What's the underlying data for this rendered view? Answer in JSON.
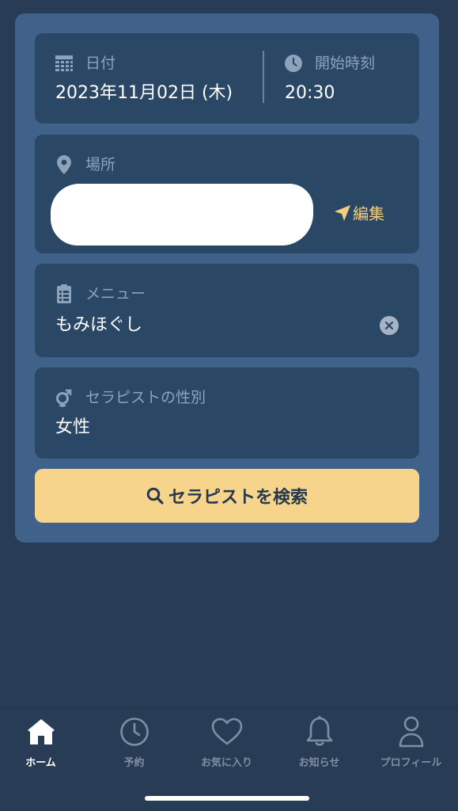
{
  "search_form": {
    "date": {
      "label": "日付",
      "value": "2023年11月02日 (木)"
    },
    "start_time": {
      "label": "開始時刻",
      "value": "20:30"
    },
    "location": {
      "label": "場所",
      "edit_label": "編集"
    },
    "menu": {
      "label": "メニュー",
      "value": "もみほぐし"
    },
    "therapist_gender": {
      "label": "セラピストの性別",
      "value": "女性"
    },
    "search_button_label": "セラピストを検索"
  },
  "tabbar": {
    "items": [
      {
        "label": "ホーム",
        "icon": "home-icon",
        "active": true
      },
      {
        "label": "予約",
        "icon": "clock-icon",
        "active": false
      },
      {
        "label": "お気に入り",
        "icon": "heart-icon",
        "active": false
      },
      {
        "label": "お知らせ",
        "icon": "bell-icon",
        "active": false
      },
      {
        "label": "プロフィール",
        "icon": "user-icon",
        "active": false
      }
    ]
  },
  "colors": {
    "background": "#283d55",
    "card": "#406189",
    "field": "#2a4866",
    "accent": "#f7d48b",
    "edit_accent": "#f3cd80"
  }
}
